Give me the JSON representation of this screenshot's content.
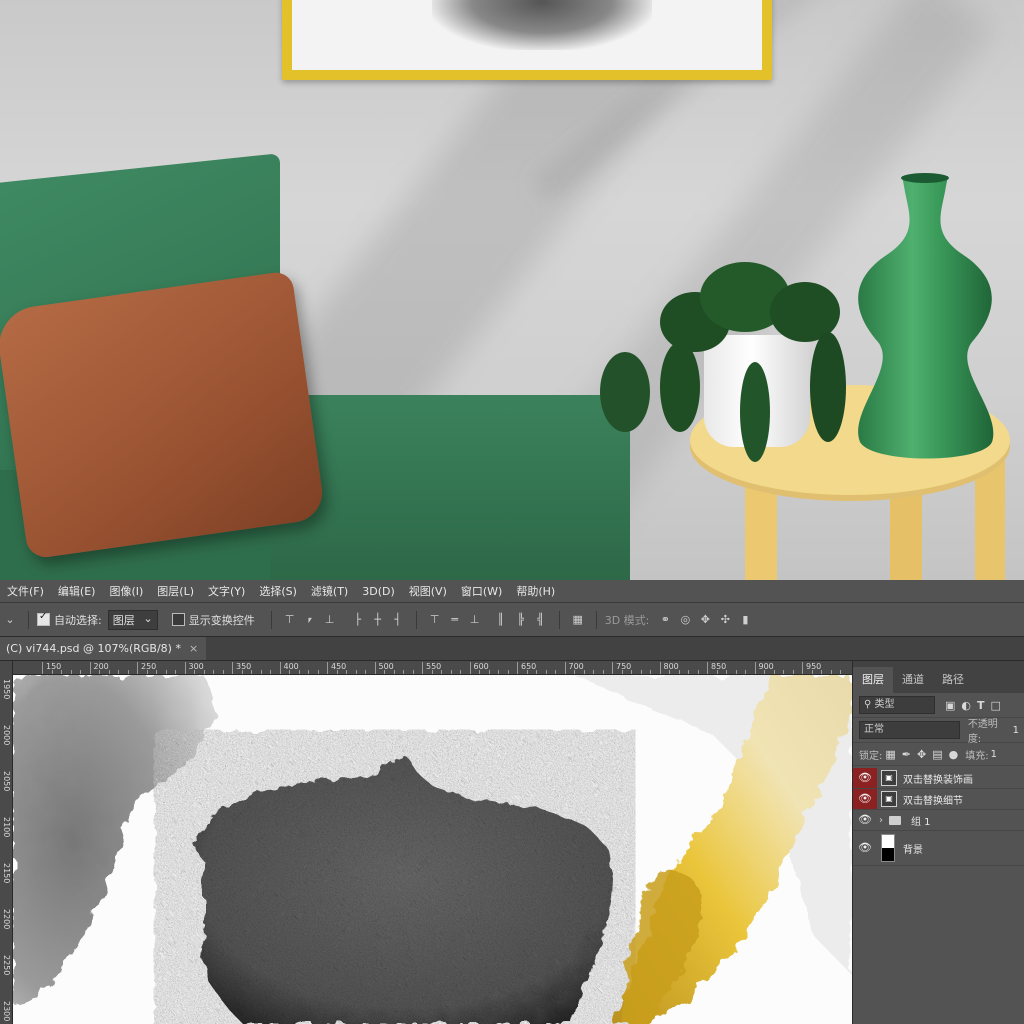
{
  "menu": [
    "文件(F)",
    "编辑(E)",
    "图像(I)",
    "图层(L)",
    "文字(Y)",
    "选择(S)",
    "滤镜(T)",
    "3D(D)",
    "视图(V)",
    "窗口(W)",
    "帮助(H)"
  ],
  "options": {
    "auto_select_label": "自动选择:",
    "auto_select_value": "图层",
    "show_transform_label": "显示变换控件",
    "mode_3d_label": "3D 模式:"
  },
  "document_tab": {
    "title": "(C) vi744.psd @ 107%(RGB/8) *",
    "close": "×"
  },
  "rulers": {
    "horizontal": [
      "150",
      "200",
      "250",
      "300",
      "350",
      "400",
      "450",
      "500",
      "550",
      "600",
      "650",
      "700",
      "750",
      "800",
      "850",
      "900",
      "950"
    ],
    "vertical": [
      "1950",
      "2000",
      "2050",
      "2100",
      "2150",
      "2200",
      "2250",
      "2300"
    ]
  },
  "layers_panel": {
    "tabs": [
      "图层",
      "通道",
      "路径"
    ],
    "filter_kind": "类型",
    "blend_mode": "正常",
    "opacity_label": "不透明度:",
    "opacity_value": "1",
    "lock_label": "锁定:",
    "fill_label": "填充:",
    "fill_value": "1",
    "layers": [
      {
        "name": "双击替换装饰画",
        "visible": true,
        "highlighted": true,
        "type": "smart"
      },
      {
        "name": "双击替换细节",
        "visible": true,
        "highlighted": true,
        "type": "smart"
      },
      {
        "name": "组 1",
        "visible": true,
        "highlighted": false,
        "type": "group"
      },
      {
        "name": "背景",
        "visible": true,
        "highlighted": false,
        "type": "background"
      }
    ]
  },
  "colors": {
    "ui_dark": "#535353",
    "ui_darker": "#424242",
    "eye_highlight": "#8b2121",
    "frame_gold": "#e2c12a",
    "sofa_green": "#3f8a63",
    "pillow_brown": "#a85d3a",
    "table_yellow": "#f3d98c"
  }
}
